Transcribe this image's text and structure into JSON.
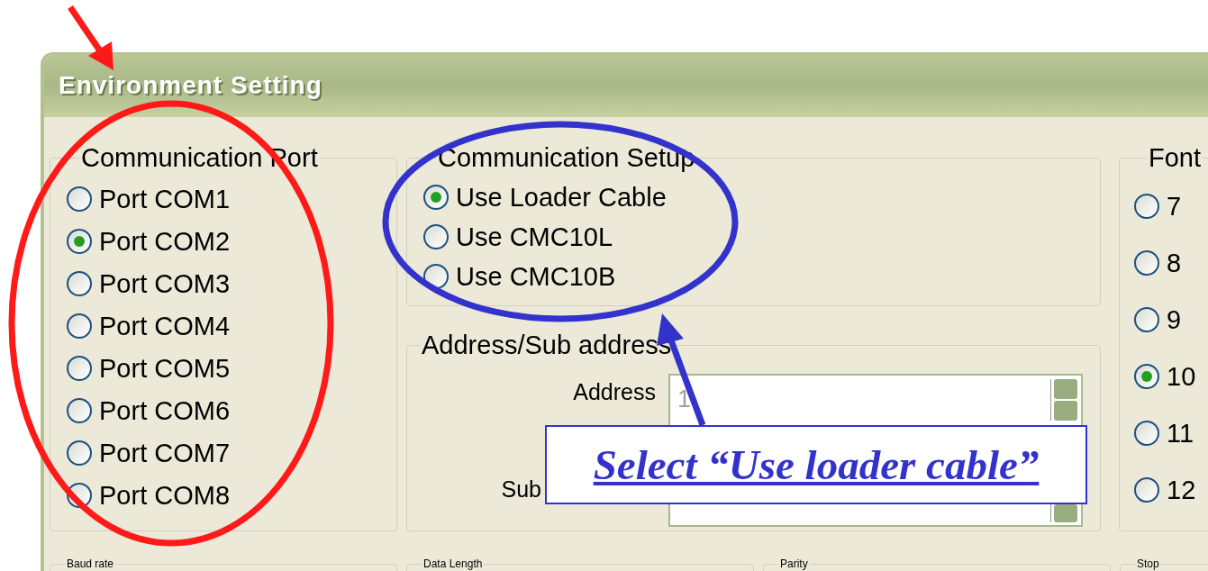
{
  "window": {
    "title": "Environment Setting"
  },
  "communication_port": {
    "title": "Communication Port",
    "options": [
      {
        "label": "Port COM1",
        "selected": false
      },
      {
        "label": "Port COM2",
        "selected": true
      },
      {
        "label": "Port COM3",
        "selected": false
      },
      {
        "label": "Port COM4",
        "selected": false
      },
      {
        "label": "Port COM5",
        "selected": false
      },
      {
        "label": "Port COM6",
        "selected": false
      },
      {
        "label": "Port COM7",
        "selected": false
      },
      {
        "label": "Port COM8",
        "selected": false
      }
    ]
  },
  "communication_setup": {
    "title": "Communication Setup",
    "options": [
      {
        "label": "Use Loader Cable",
        "selected": true
      },
      {
        "label": "Use CMC10L",
        "selected": false
      },
      {
        "label": "Use CMC10B",
        "selected": false
      }
    ]
  },
  "address": {
    "title": "Address/Sub address",
    "fields": [
      {
        "label": "Address",
        "value": "1",
        "disabled": true
      },
      {
        "label": "Sub",
        "disabled": true
      }
    ]
  },
  "font": {
    "title": "Font",
    "options": [
      {
        "label": "7",
        "selected": false
      },
      {
        "label": "8",
        "selected": false
      },
      {
        "label": "9",
        "selected": false
      },
      {
        "label": "10",
        "selected": true
      },
      {
        "label": "11",
        "selected": false
      },
      {
        "label": "12",
        "selected": false
      }
    ]
  },
  "bottom_groups": [
    "Baud rate",
    "Data Length",
    "Parity",
    "Stop"
  ],
  "callout": {
    "text": "Select “Use loader cable”"
  }
}
